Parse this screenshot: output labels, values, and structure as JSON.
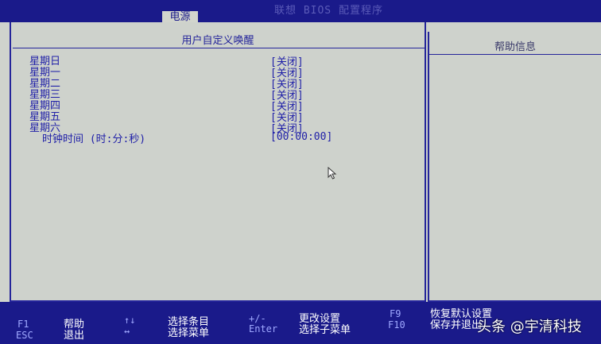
{
  "header": {
    "bios_title": "联想 BIOS 配置程序",
    "tab": "电源"
  },
  "section": {
    "title": "用户自定义唤醒",
    "items": [
      {
        "label": "星期日",
        "value": "[关闭]"
      },
      {
        "label": "星期一",
        "value": "[关闭]"
      },
      {
        "label": "星期二",
        "value": "[关闭]"
      },
      {
        "label": "星期三",
        "value": "[关闭]"
      },
      {
        "label": "星期四",
        "value": "[关闭]"
      },
      {
        "label": "星期五",
        "value": "[关闭]"
      },
      {
        "label": "星期六",
        "value": "[关闭]"
      },
      {
        "label": "时钟时间 (时:分:秒)",
        "value": "[00:00:00]"
      }
    ]
  },
  "help": {
    "title": "帮助信息"
  },
  "footer": {
    "keys": [
      {
        "key": "F1",
        "desc": "帮助"
      },
      {
        "key": "ESC",
        "desc": "退出"
      },
      {
        "key": "↑↓",
        "desc": "选择条目"
      },
      {
        "key": "↔",
        "desc": "选择菜单"
      },
      {
        "key": "+/-",
        "desc": "更改设置"
      },
      {
        "key": "Enter",
        "desc": "选择子菜单"
      },
      {
        "key": "F9",
        "desc": "恢复默认设置"
      },
      {
        "key": "F10",
        "desc": "保存并退出"
      }
    ]
  },
  "watermark": "头条 @宇清科技",
  "colors": {
    "bar_blue": "#1a1a8a",
    "text_blue": "#2020a8",
    "background": "#cfd3cd"
  }
}
